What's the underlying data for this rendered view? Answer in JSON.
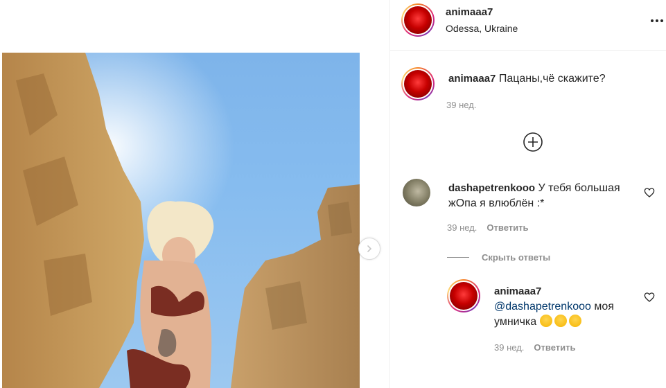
{
  "post": {
    "username": "animaaa7",
    "location": "Odessa, Ukraine",
    "caption_user": "animaaa7",
    "caption_text": "Пацаны,чё скажите?",
    "caption_time": "39 нед."
  },
  "comments": [
    {
      "username": "dashapetrenkooo",
      "text": "У тебя большая жОпа я влюблён :*",
      "time": "39 нед.",
      "reply_label": "Ответить",
      "hide_replies_label": "Скрыть ответы",
      "replies": [
        {
          "username": "animaaa7",
          "mention": "@dashapetrenkooo",
          "text": "моя умничка",
          "time": "39 нед.",
          "reply_label": "Ответить"
        }
      ]
    }
  ],
  "icons": {
    "more": "more-options-icon",
    "add": "plus-circle-icon",
    "like": "heart-icon",
    "next": "chevron-right-icon"
  },
  "colors": {
    "text": "#262626",
    "muted": "#8e8e8e",
    "mention": "#00376b",
    "sky": "#86bcef",
    "rock": "#c49a5a"
  }
}
